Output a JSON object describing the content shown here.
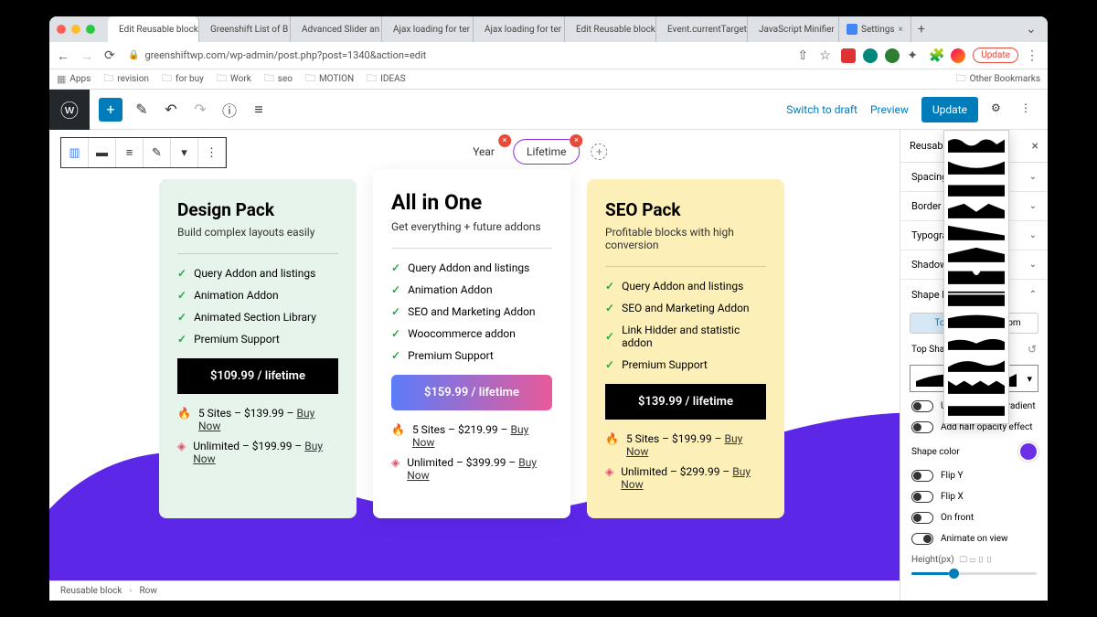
{
  "browser": {
    "tabs": [
      {
        "label": "Edit Reusable block",
        "active": true
      },
      {
        "label": "Greenshift List of B"
      },
      {
        "label": "Advanced Slider an"
      },
      {
        "label": "Ajax loading for ter"
      },
      {
        "label": "Ajax loading for ter"
      },
      {
        "label": "Edit Reusable block"
      },
      {
        "label": "Event.currentTarget"
      },
      {
        "label": "JavaScript Minifier"
      },
      {
        "label": "Settings"
      }
    ],
    "url": "greenshiftwp.com/wp-admin/post.php?post=1340&action=edit",
    "update": "Update",
    "bookmarks": [
      "Apps",
      "revision",
      "for buy",
      "Work",
      "seo",
      "MOTION",
      "IDEAS"
    ],
    "other_bm": "Other Bookmarks"
  },
  "editor": {
    "switch_draft": "Switch to draft",
    "preview": "Preview",
    "update": "Update",
    "pill_tabs": {
      "year": "Year",
      "lifetime": "Lifetime"
    }
  },
  "cards": {
    "design": {
      "title": "Design Pack",
      "sub": "Build complex layouts easily",
      "features": [
        "Query Addon and listings",
        "Animation Addon",
        "Animated Section Library",
        "Premium Support"
      ],
      "price": "$109.99 / lifetime",
      "offer1": "5 Sites – $139.99 – ",
      "buy1": "Buy Now",
      "offer2": "Unlimited – $199.99 – ",
      "buy2": "Buy Now"
    },
    "all": {
      "title": "All in One",
      "sub": "Get everything + future addons",
      "features": [
        "Query Addon and listings",
        "Animation Addon",
        "SEO and Marketing Addon",
        "Woocommerce addon",
        "Premium Support"
      ],
      "price": "$159.99 / lifetime",
      "offer1": "5 Sites – $219.99 – ",
      "buy1": "Buy Now",
      "offer2": "Unlimited – $399.99 – ",
      "buy2": "Buy Now"
    },
    "seo": {
      "title": "SEO Pack",
      "sub": "Profitable blocks with high conversion",
      "features": [
        "Query Addon and listings",
        "SEO and Marketing Addon",
        "Link Hidder and statistic addon",
        "Premium Support"
      ],
      "price": "$139.99 / lifetime",
      "offer1": "5 Sites – $199.99 – ",
      "buy1": "Buy Now",
      "offer2": "Unlimited – $299.99 – ",
      "buy2": "Buy Now"
    }
  },
  "sidebar": {
    "tab": "Reusable",
    "sections": [
      "Spacing",
      "Border",
      "Typography",
      "Shadow",
      "Shape Divider"
    ],
    "sub_tabs": {
      "top": "Top",
      "bottom": "Bottom"
    },
    "top_shape": "Top Shape",
    "adv_grad": "Use Advanced Gradient",
    "half_op": "Add half opacity effect",
    "shape_color": "Shape color",
    "flip_y": "Flip Y",
    "flip_x": "Flip X",
    "on_front": "On front",
    "animate": "Animate on view",
    "height": "Height(px)"
  },
  "breadcrumb": {
    "a": "Reusable block",
    "b": "Row"
  }
}
